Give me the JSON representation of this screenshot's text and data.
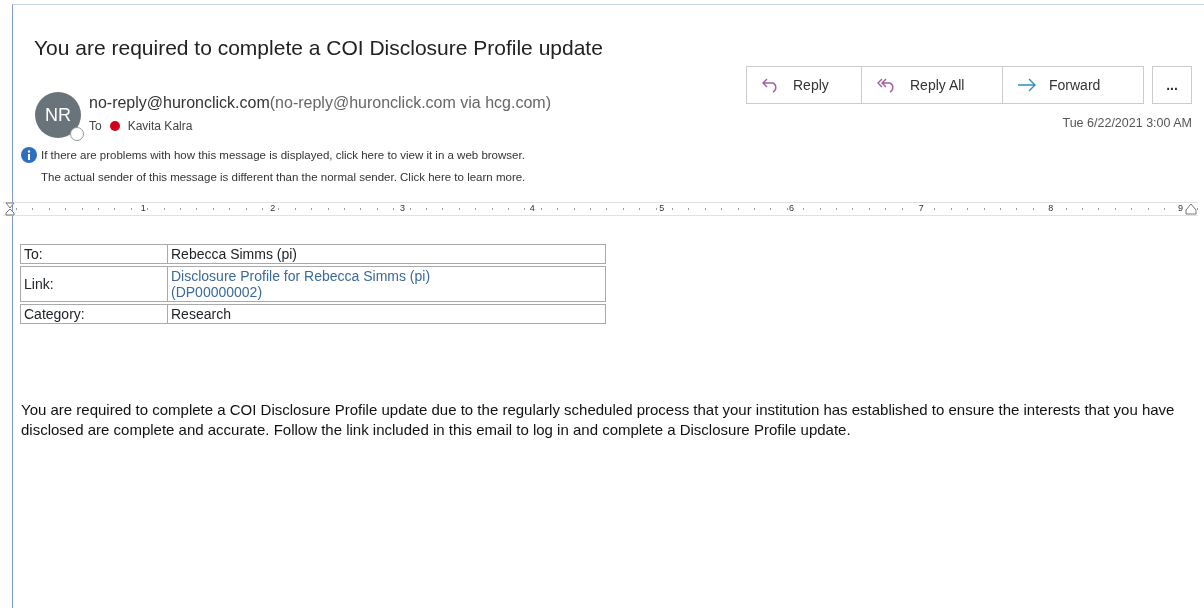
{
  "message": {
    "subject": "You are required to complete a COI Disclosure Profile update",
    "avatar_initials": "NR",
    "sender": "no-reply@huronclick.com",
    "sender_detail": "(no-reply@huronclick.com via hcg.com)",
    "to_label": "To",
    "recipient": {
      "name": "Kavita Kalra",
      "color": "#d0021b"
    },
    "info_lines": [
      "If there are problems with how this message is displayed, click here to view it in a web browser.",
      "The actual sender of this message is different than the normal sender. Click here to learn more."
    ],
    "actions": [
      {
        "kind": "reply",
        "label": "Reply"
      },
      {
        "kind": "reply-all",
        "label": "Reply All"
      },
      {
        "kind": "forward",
        "label": "Forward"
      }
    ],
    "more_label": "...",
    "date": "Tue 6/22/2021 3:00 AM"
  },
  "ruler": {
    "numbers": [
      "1",
      "2",
      "3",
      "4",
      "5",
      "6",
      "7",
      "8",
      "9"
    ]
  },
  "details": [
    {
      "label": "To:",
      "value": "Rebecca Simms (pi)",
      "is_link": false
    },
    {
      "label": "Link:",
      "value": "Disclosure Profile for Rebecca Simms (pi) (DP00000002)",
      "is_link": true
    },
    {
      "label": "Category:",
      "value": "Research",
      "is_link": false
    }
  ],
  "body": "You are required to complete a COI Disclosure Profile update due to the regularly scheduled process that your institution has established to ensure the interests that you have disclosed are complete and accurate. Follow the link included in this email to log in and complete a Disclosure Profile update."
}
